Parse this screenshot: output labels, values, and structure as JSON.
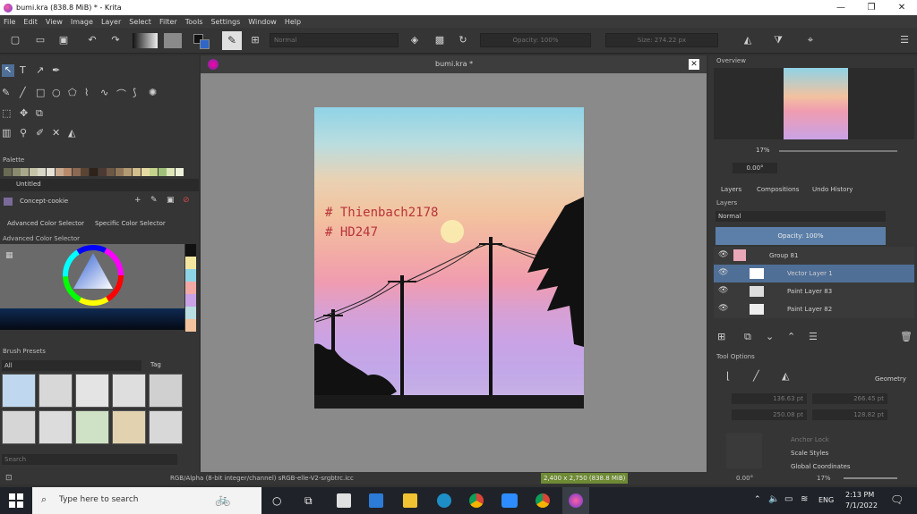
{
  "window": {
    "title": "bumi.kra (838.8 MiB) * - Krita",
    "min": "—",
    "max": "❐",
    "close": "✕"
  },
  "menu": [
    "File",
    "Edit",
    "View",
    "Image",
    "Layer",
    "Select",
    "Filter",
    "Tools",
    "Settings",
    "Window",
    "Help"
  ],
  "toolbar": {
    "blend_mode": "Normal",
    "opacity": "Opacity: 100%",
    "size": "Size: 274.22 px"
  },
  "document": {
    "tab_title": "bumi.kra *"
  },
  "artwork": {
    "line1": "# Thienbach2178",
    "line2": "# HD247"
  },
  "left_panels": {
    "palette_title": "Palette",
    "palette_name": "Untitled",
    "concept": "Concept-cookie",
    "tabs": [
      "Advanced Color Selector",
      "Specific Color Selector"
    ],
    "adv_color_title": "Advanced Color Selector",
    "brush_presets_title": "Brush Presets",
    "brush_filter": "All",
    "brush_tag": "Tag",
    "search": "Search"
  },
  "right_panels": {
    "overview_title": "Overview",
    "zoom": "17%",
    "rotation": "0.00°",
    "tabs": [
      "Layers",
      "Compositions",
      "Undo History"
    ],
    "layers_title": "Layers",
    "blend_mode": "Normal",
    "opacity": "Opacity:  100%",
    "layers": [
      {
        "name": "Group 81",
        "selected": false
      },
      {
        "name": "Vector Layer 1",
        "selected": true
      },
      {
        "name": "Paint Layer 83",
        "selected": false
      },
      {
        "name": "Paint Layer 82",
        "selected": false
      }
    ],
    "tool_options_title": "Tool Options",
    "geometry": "Geometry",
    "x": "136.63 pt",
    "y": "250.08 pt",
    "w": "266.45 pt",
    "h": "128.82 pt",
    "anchor_lock": "Anchor Lock",
    "scale_styles": "Scale Styles",
    "global_coords": "Global Coordinates"
  },
  "statusbar": {
    "color_info": "RGB/Alpha (8-bit integer/channel)  sRGB-elle-V2-srgbtrc.icc",
    "size_info": "2,400 x 2,750 (838.8 MiB)",
    "rotation": "0.00°",
    "zoom": "17%"
  },
  "taskbar": {
    "search_placeholder": "Type here to search",
    "lang": "ENG",
    "time": "2:13 PM",
    "date": "7/1/2022"
  },
  "palette_colors": [
    "#6b6b55",
    "#8a8a6e",
    "#a9a88b",
    "#c5c4a9",
    "#d8d6c6",
    "#e6e2d7",
    "#c9a98e",
    "#b78a6c",
    "#8a6a55",
    "#5b4433",
    "#2e2219",
    "#4a3a33",
    "#6d5844",
    "#91775a",
    "#b49a73",
    "#d4c08e",
    "#e6dca3",
    "#c4d48c",
    "#9fc07a",
    "#dfe6b9",
    "#eef2da"
  ]
}
